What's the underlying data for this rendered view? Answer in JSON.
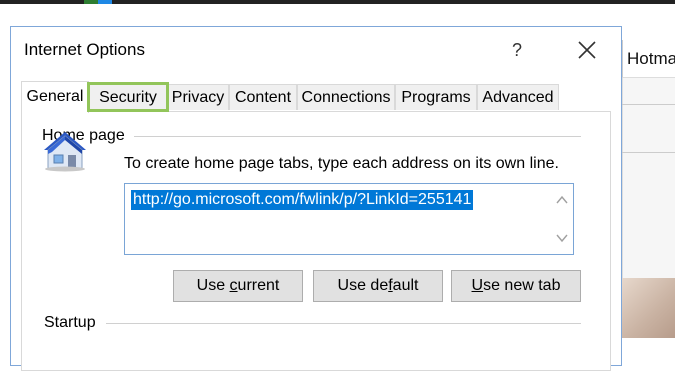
{
  "background": {
    "partial_tab_label": "Hotma"
  },
  "dialog": {
    "title": "Internet Options",
    "help_label": "?",
    "tabs": [
      {
        "label": "General",
        "active": true
      },
      {
        "label": "Security",
        "highlighted": true
      },
      {
        "label": "Privacy"
      },
      {
        "label": "Content"
      },
      {
        "label": "Connections"
      },
      {
        "label": "Programs"
      },
      {
        "label": "Advanced"
      }
    ]
  },
  "home_page": {
    "group_label": "Home page",
    "instruction": "To create home page tabs, type each address on its own line.",
    "url_value": "http://go.microsoft.com/fwlink/p/?LinkId=255141",
    "buttons": {
      "use_current": {
        "pre": "Use ",
        "key": "c",
        "post": "urrent"
      },
      "use_default": {
        "pre": "Use de",
        "key": "f",
        "post": "ault"
      },
      "use_new_tab": {
        "pre": "",
        "key": "U",
        "post": "se new tab"
      }
    }
  },
  "startup": {
    "group_label": "Startup"
  },
  "colors": {
    "highlight_outline": "#92c55a",
    "selection": "#0078d7",
    "dialog_border": "#7fa7d9"
  }
}
